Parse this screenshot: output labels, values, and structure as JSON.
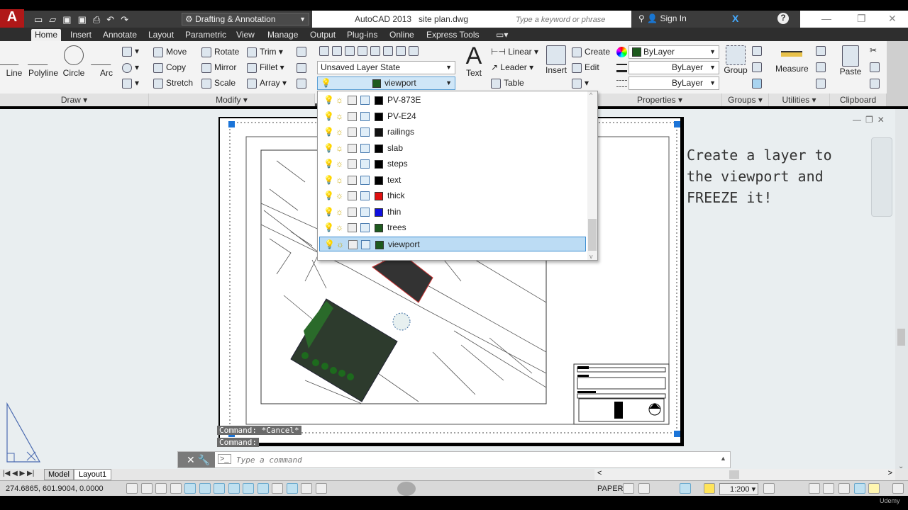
{
  "title_bar": {
    "workspace": "Drafting & Annotation",
    "title": "AutoCAD 2013   site plan.dwg",
    "search_placeholder": "Type a keyword or phrase",
    "sign_in": "Sign In"
  },
  "tabs": [
    "Home",
    "Insert",
    "Annotate",
    "Layout",
    "Parametric",
    "View",
    "Manage",
    "Output",
    "Plug-ins",
    "Online",
    "Express Tools"
  ],
  "active_tab": "Home",
  "draw": {
    "label": "Draw ▾",
    "tools": [
      "Line",
      "Polyline",
      "Circle",
      "Arc"
    ]
  },
  "modify": {
    "label": "Modify ▾",
    "tools": [
      "Move",
      "Rotate",
      "Trim",
      "Copy",
      "Mirror",
      "Fillet",
      "Stretch",
      "Scale",
      "Array"
    ]
  },
  "layers": {
    "state": "Unsaved Layer State",
    "current": "viewport",
    "current_color": "#1e5a1e",
    "list": [
      {
        "name": "PV-873E",
        "color": "#000000"
      },
      {
        "name": "PV-E24",
        "color": "#000000"
      },
      {
        "name": "railings",
        "color": "#111111"
      },
      {
        "name": "slab",
        "color": "#000000"
      },
      {
        "name": "steps",
        "color": "#000000"
      },
      {
        "name": "text",
        "color": "#000000"
      },
      {
        "name": "thick",
        "color": "#e01010"
      },
      {
        "name": "thin",
        "color": "#1010e0"
      },
      {
        "name": "trees",
        "color": "#1e5a1e"
      },
      {
        "name": "viewport",
        "color": "#1e5a1e",
        "selected": true
      }
    ]
  },
  "annotation": {
    "text": "Text",
    "linear": "Linear",
    "leader": "Leader",
    "table": "Table"
  },
  "block": {
    "insert": "Insert",
    "create": "Create",
    "edit": "Edit"
  },
  "properties": {
    "label": "Properties ▾",
    "color": "ByLayer",
    "lineweight": "ByLayer",
    "linetype": "ByLayer"
  },
  "groups": {
    "label": "Groups ▾",
    "group": "Group"
  },
  "utilities": {
    "label": "Utilities ▾",
    "measure": "Measure"
  },
  "clipboard": {
    "label": "Clipboard",
    "paste": "Paste"
  },
  "note": "Create a layer to\nthe viewport and\nFREEZE it!",
  "command_history": [
    "Command: *Cancel*",
    "Command:"
  ],
  "command_placeholder": "Type a command",
  "layout_tabs": [
    "Model",
    "Layout1"
  ],
  "status": {
    "coords": "274.6865, 601.9004, 0.0000",
    "space": "PAPER",
    "scale": "1:200"
  },
  "brand": "Udemy"
}
